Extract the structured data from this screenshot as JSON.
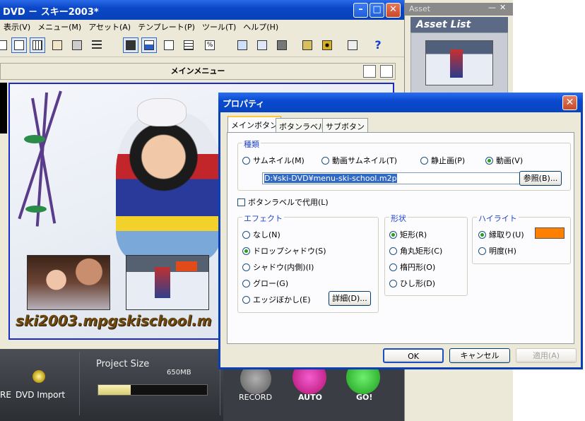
{
  "main_window": {
    "title": "DVD － スキー2003*",
    "menu": [
      "表示(V)",
      "メニュー(M)",
      "アセット(A)",
      "テンプレート(P)",
      "ツール(T)",
      "ヘルプ(H)"
    ],
    "menu_header": "メインメニュー",
    "caption": "ski2003.mpgskischool.m",
    "bottom": {
      "left_label": "RE",
      "dvd_import": "DVD Import",
      "project_size_label": "Project Size",
      "size_tick": "650MB",
      "project_size_fill": 0.3,
      "record": "RECORD",
      "auto": "AUTO",
      "go": "GO!"
    }
  },
  "asset_panel": {
    "title": "Asset",
    "list_header": "Asset List"
  },
  "dialog": {
    "title": "プロパティ",
    "tabs": [
      "メインボタン",
      "ボタンラベル",
      "サブボタン"
    ],
    "type_group": {
      "label": "種類",
      "options": [
        "サムネイル(M)",
        "動画サムネイル(T)",
        "静止画(P)",
        "動画(V)"
      ],
      "selected": "動画(V)",
      "path": "D:¥ski-DVD¥menu-ski-school.m2p",
      "browse": "参照(B)..."
    },
    "replace_with_label": "ボタンラベルで代用(L)",
    "effect_group": {
      "label": "エフェクト",
      "options": [
        "なし(N)",
        "ドロップシャドウ(S)",
        "シャドウ(内側)(I)",
        "グロー(G)",
        "エッジぼかし(E)"
      ],
      "selected": "ドロップシャドウ(S)",
      "details": "詳細(D)..."
    },
    "shape_group": {
      "label": "形状",
      "options": [
        "矩形(R)",
        "角丸矩形(C)",
        "楕円形(O)",
        "ひし形(D)"
      ],
      "selected": "矩形(R)"
    },
    "highlight_group": {
      "label": "ハイライト",
      "options": [
        "縁取り(U)",
        "明度(H)"
      ],
      "selected": "縁取り(U)",
      "color": "#ff7f00"
    },
    "ok": "OK",
    "cancel": "キャンセル",
    "apply": "適用(A)"
  }
}
